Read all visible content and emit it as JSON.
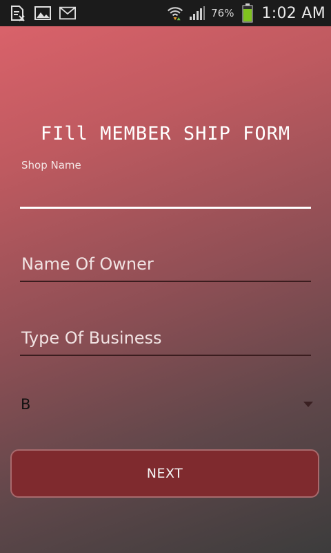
{
  "status_bar": {
    "battery_percent": "76%",
    "time": "1:02 AM",
    "icons": [
      "document-icon",
      "image-icon",
      "gmail-icon",
      "wifi-icon",
      "signal-icon",
      "battery-icon"
    ]
  },
  "form": {
    "title": "FIll MEMBER SHIP FORM",
    "shop_name_label": "Shop Name",
    "shop_name_value": "",
    "owner_placeholder": "Name Of Owner",
    "business_placeholder": "Type Of Business",
    "spinner_value": "B",
    "next_label": "NEXT"
  },
  "colors": {
    "accent": "#7f2a2e",
    "gradient_top": "#d9626a",
    "gradient_bottom": "#3c3c3c"
  }
}
